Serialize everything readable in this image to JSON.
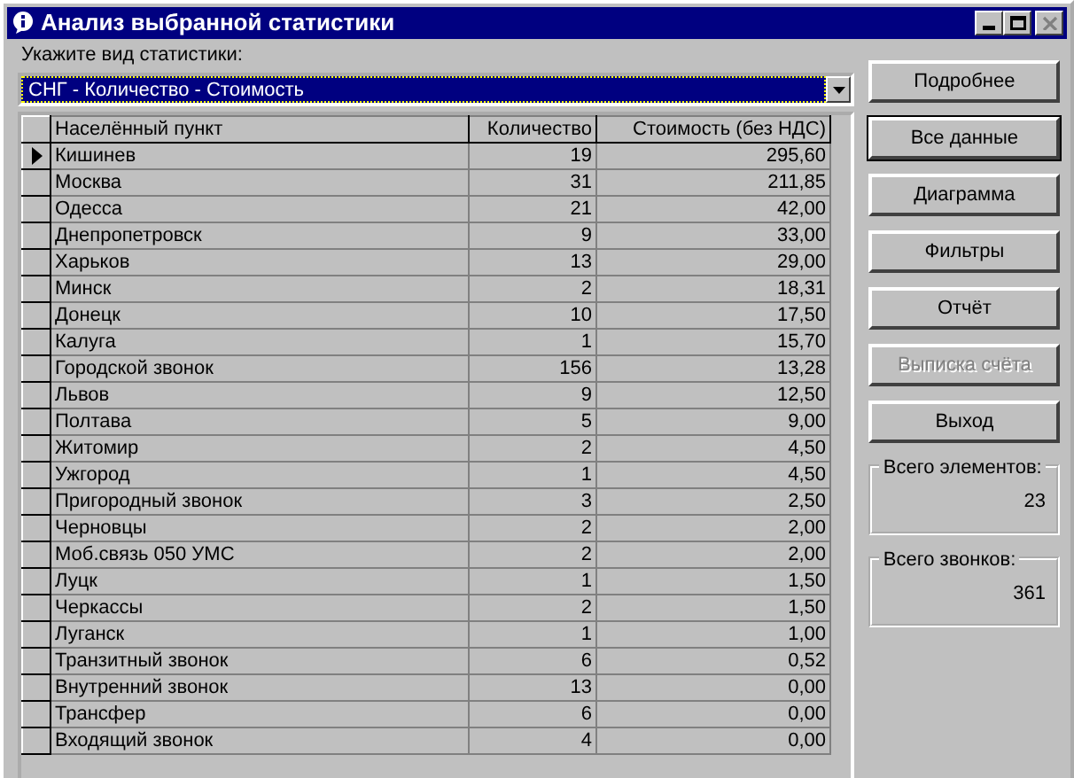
{
  "window": {
    "title": "Анализ выбранной статистики",
    "controls": [
      {
        "kind": "minimize",
        "disabled": false
      },
      {
        "kind": "maximize",
        "disabled": false
      },
      {
        "kind": "close",
        "disabled": true
      }
    ]
  },
  "stat_type": {
    "label": "Укажите вид статистики:",
    "value": "СНГ - Количество - Стоимость"
  },
  "table": {
    "columns": [
      "Населённый пункт",
      "Количество",
      "Стоимость (без НДС)"
    ],
    "rows": [
      {
        "cells": [
          "Кишинев",
          "19",
          "295,60"
        ],
        "current": true
      },
      {
        "cells": [
          "Москва",
          "31",
          "211,85"
        ],
        "current": false
      },
      {
        "cells": [
          "Одесса",
          "21",
          "42,00"
        ],
        "current": false
      },
      {
        "cells": [
          "Днепропетровск",
          "9",
          "33,00"
        ],
        "current": false
      },
      {
        "cells": [
          "Харьков",
          "13",
          "29,00"
        ],
        "current": false
      },
      {
        "cells": [
          "Минск",
          "2",
          "18,31"
        ],
        "current": false
      },
      {
        "cells": [
          "Донецк",
          "10",
          "17,50"
        ],
        "current": false
      },
      {
        "cells": [
          "Калуга",
          "1",
          "15,70"
        ],
        "current": false
      },
      {
        "cells": [
          "Городской звонок",
          "156",
          "13,28"
        ],
        "current": false
      },
      {
        "cells": [
          "Львов",
          "9",
          "12,50"
        ],
        "current": false
      },
      {
        "cells": [
          "Полтава",
          "5",
          "9,00"
        ],
        "current": false
      },
      {
        "cells": [
          "Житомир",
          "2",
          "4,50"
        ],
        "current": false
      },
      {
        "cells": [
          "Ужгород",
          "1",
          "4,50"
        ],
        "current": false
      },
      {
        "cells": [
          "Пригородный звонок",
          "3",
          "2,50"
        ],
        "current": false
      },
      {
        "cells": [
          "Черновцы",
          "2",
          "2,00"
        ],
        "current": false
      },
      {
        "cells": [
          "Моб.связь 050 УМС",
          "2",
          "2,00"
        ],
        "current": false
      },
      {
        "cells": [
          "Луцк",
          "1",
          "1,50"
        ],
        "current": false
      },
      {
        "cells": [
          "Черкассы",
          "2",
          "1,50"
        ],
        "current": false
      },
      {
        "cells": [
          "Луганск",
          "1",
          "1,00"
        ],
        "current": false
      },
      {
        "cells": [
          "Транзитный звонок",
          "6",
          "0,52"
        ],
        "current": false
      },
      {
        "cells": [
          "Внутренний звонок",
          "13",
          "0,00"
        ],
        "current": false
      },
      {
        "cells": [
          "Трансфер",
          "6",
          "0,00"
        ],
        "current": false
      },
      {
        "cells": [
          "Входящий звонок",
          "4",
          "0,00"
        ],
        "current": false
      }
    ]
  },
  "buttons": [
    {
      "label": "Подробнее",
      "default": false,
      "disabled": false
    },
    {
      "label": "Все данные",
      "default": true,
      "disabled": false
    },
    {
      "label": "Диаграмма",
      "default": false,
      "disabled": false
    },
    {
      "label": "Фильтры",
      "default": false,
      "disabled": false
    },
    {
      "label": "Отчёт",
      "default": false,
      "disabled": false
    },
    {
      "label": "Выписка счёта",
      "default": false,
      "disabled": true
    },
    {
      "label": "Выход",
      "default": false,
      "disabled": false
    }
  ],
  "totals": [
    {
      "label": "Всего элементов:",
      "value": "23"
    },
    {
      "label": "Всего звонков:",
      "value": "361"
    }
  ]
}
